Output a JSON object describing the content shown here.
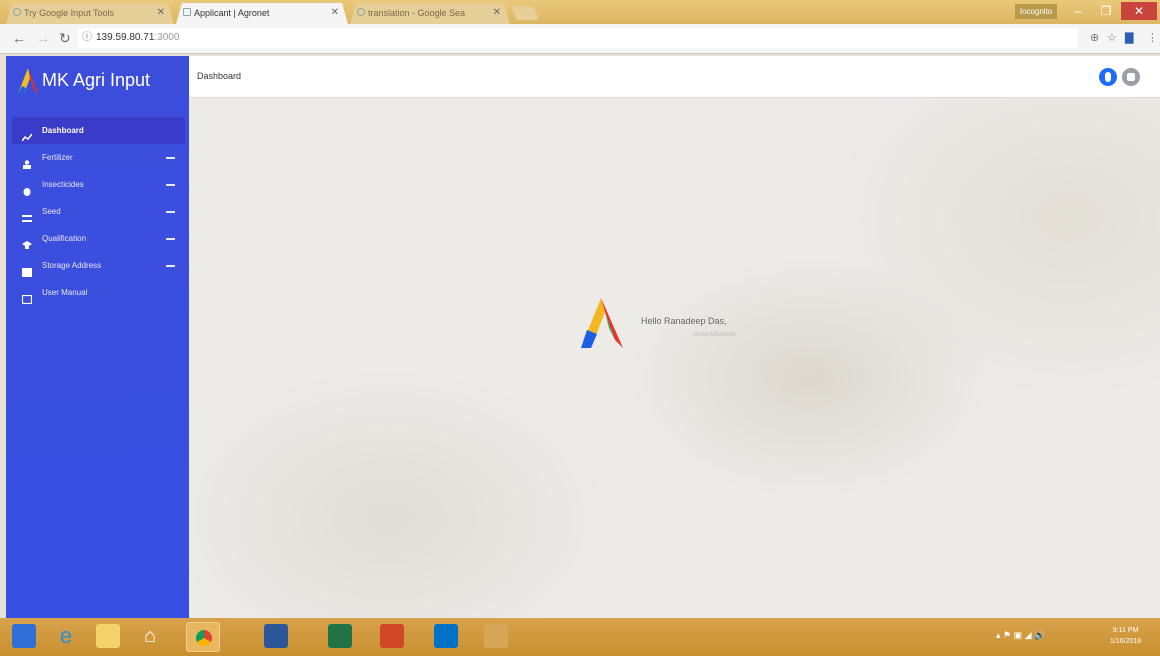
{
  "browser": {
    "tabs": [
      {
        "title": "Try Google Input Tools",
        "active": false
      },
      {
        "title": "Applicant | Agronet",
        "active": true
      },
      {
        "title": "translation - Google Sea",
        "active": false
      }
    ],
    "profile": "Incognito",
    "url_host": "139.59.80.71",
    "url_port": ":3000"
  },
  "app": {
    "brand": "MK Agri Input",
    "page_title": "Dashboard",
    "menu": [
      {
        "label": "Dashboard",
        "icon": "chart-line-icon",
        "active": true,
        "expandable": false
      },
      {
        "label": "Fertilizer",
        "icon": "user-icon",
        "active": false,
        "expandable": true
      },
      {
        "label": "Insecticides",
        "icon": "bug-icon",
        "active": false,
        "expandable": true
      },
      {
        "label": "Seed",
        "icon": "seed-icon",
        "active": false,
        "expandable": true
      },
      {
        "label": "Qualification",
        "icon": "graduation-cap-icon",
        "active": false,
        "expandable": true
      },
      {
        "label": "Storage Address",
        "icon": "building-icon",
        "active": false,
        "expandable": true
      },
      {
        "label": "User Manual",
        "icon": "book-icon",
        "active": false,
        "expandable": false
      }
    ],
    "welcome": {
      "greeting": "Hello Ranadeep Das,",
      "subtitle": "Good Afternoon"
    }
  },
  "taskbar": {
    "clock_time": "9:11 PM",
    "clock_date": "1/16/2018"
  },
  "colors": {
    "sidebar": "#3d4ddb",
    "sidebar_active": "#3a3bc8",
    "taskbar": "#d9a24c",
    "notification_icon": "#1f6bff"
  }
}
